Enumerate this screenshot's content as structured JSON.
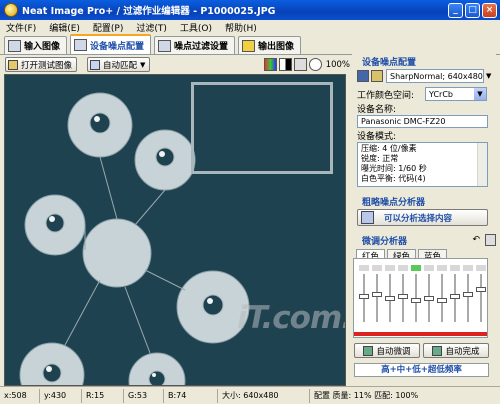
{
  "window": {
    "title": "Neat Image Pro+ / 过滤作业编辑器 - P1000025.JPG",
    "minimize": "_",
    "maximize": "□",
    "close": "×"
  },
  "menu": [
    "文件(F)",
    "编辑(E)",
    "配置(P)",
    "过滤(T)",
    "工具(O)",
    "帮助(H)"
  ],
  "tabs": [
    {
      "label": "输入图像",
      "active": false
    },
    {
      "label": "设备噪点配置",
      "active": true
    },
    {
      "label": "噪点过滤设置",
      "active": false
    },
    {
      "label": "输出图像",
      "active": false
    }
  ],
  "toolbar": {
    "open_test_image": "打开测试图像",
    "auto_match": "自动匹配",
    "zoom": "100%"
  },
  "panel": {
    "title": "设备噪点配置",
    "profile_combo": "SharpNormal; 640x480",
    "color_space_label": "工作颜色空间:",
    "color_space_value": "YCrCb",
    "device_name_label": "设备名称:",
    "device_name_value": "Panasonic DMC-FZ20",
    "device_mode_label": "设备模式:",
    "device_mode_lines": [
      "压缩: 4 位/像素",
      "锐度: 正常",
      "曝光时间: 1/60 秒",
      "白色平衡: 代码(4)"
    ],
    "coarse_title": "粗略噪点分析器",
    "coarse_button": "可以分析选择内容",
    "fine_title": "微调分析器",
    "color_tabs": [
      "红色",
      "绿色",
      "蓝色"
    ],
    "auto_fine_tune": "自动微调",
    "auto_complete": "自动完成",
    "freq_label": "高+中+低+超低频率"
  },
  "status": {
    "x": "x:508",
    "y": "y:430",
    "r": "R:15",
    "g": "G:53",
    "b": "B:74",
    "size": "大小: 640x480",
    "config": "配置 质量: 11% 匹配: 100%"
  },
  "watermark": "iT.com.cn",
  "sliders": [
    0.55,
    0.6,
    0.5,
    0.55,
    0.45,
    0.5,
    0.45,
    0.55,
    0.6,
    0.7
  ],
  "colors": {
    "accent": "#1f4fa8",
    "image_bg": "#1f4250",
    "active_tab": "#f5a623"
  }
}
